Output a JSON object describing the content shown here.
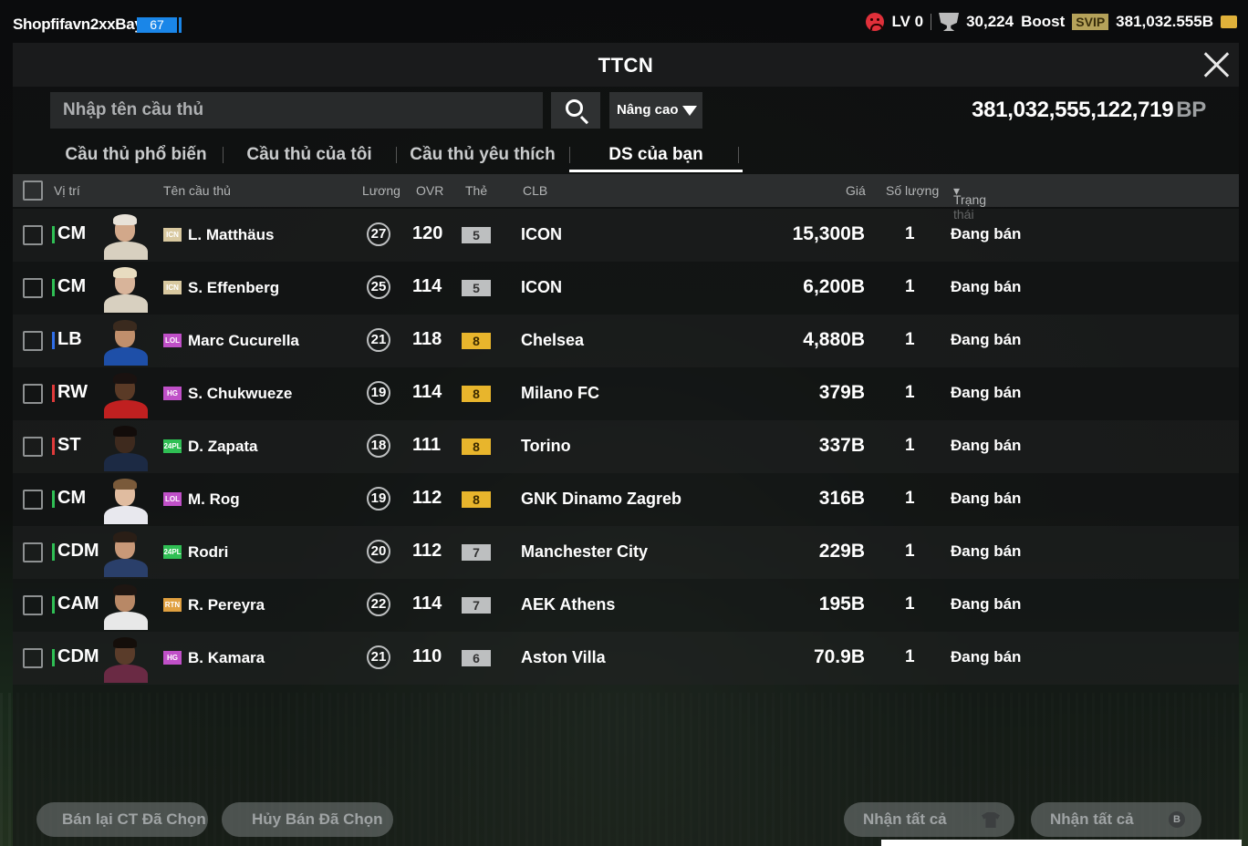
{
  "topbar": {
    "username": "Shopfifavn2xxBay",
    "level_badge": "67",
    "lv": "LV 0",
    "trophies": "30,224",
    "boost": "Boost",
    "svip": "SVIP",
    "coins": "381,032.555B"
  },
  "header": {
    "title": "TTCN"
  },
  "search": {
    "placeholder": "Nhập tên cầu thủ",
    "advanced_label": "Nâng cao"
  },
  "balance": {
    "amount": "381,032,555,122,719",
    "unit": "BP"
  },
  "tabs": [
    {
      "label": "Cầu thủ phổ biến"
    },
    {
      "label": "Cầu thủ của tôi"
    },
    {
      "label": "Cầu thủ yêu thích"
    },
    {
      "label": "DS của bạn"
    }
  ],
  "columns": {
    "position": "Vị trí",
    "name": "Tên cầu thủ",
    "salary": "Lương",
    "ovr": "OVR",
    "grade": "Thẻ",
    "club": "CLB",
    "price": "Giá",
    "quantity": "Số lượng",
    "status": "Trạng thái"
  },
  "rows": [
    {
      "pos": "CM",
      "pos_color": "#2fbf54",
      "season": "ICN",
      "season_color": "#d9c9a0",
      "name": "L. Matthäus",
      "salary": "27",
      "ovr": "120",
      "grade": "5",
      "grade_color": "#bdbfc0",
      "club": "ICON",
      "price": "15,300B",
      "qty": "1",
      "status": "Đang bán",
      "skin": "#d2a88a",
      "hair": "#e8e2d8",
      "shirt": "#d8d0c0"
    },
    {
      "pos": "CM",
      "pos_color": "#2fbf54",
      "season": "ICN",
      "season_color": "#d9c9a0",
      "name": "S. Effenberg",
      "salary": "25",
      "ovr": "114",
      "grade": "5",
      "grade_color": "#bdbfc0",
      "club": "ICON",
      "price": "6,200B",
      "qty": "1",
      "status": "Đang bán",
      "skin": "#d8b49a",
      "hair": "#e8dcc0",
      "shirt": "#d8d0c0"
    },
    {
      "pos": "LB",
      "pos_color": "#2f6ee8",
      "season": "LOL",
      "season_color": "#c050c8",
      "name": "Marc Cucurella",
      "salary": "21",
      "ovr": "118",
      "grade": "8",
      "grade_color": "#e8b52c",
      "club": "Chelsea",
      "price": "4,880B",
      "qty": "1",
      "status": "Đang bán",
      "skin": "#c08f6c",
      "hair": "#3a2a1e",
      "shirt": "#1e4fa8"
    },
    {
      "pos": "RW",
      "pos_color": "#e03a3a",
      "season": "HG",
      "season_color": "#c050c8",
      "name": "S. Chukwueze",
      "salary": "19",
      "ovr": "114",
      "grade": "8",
      "grade_color": "#e8b52c",
      "club": "Milano FC",
      "price": "379B",
      "qty": "1",
      "status": "Đang bán",
      "skin": "#5a3a26",
      "hair": "#1a1210",
      "shirt": "#c02020"
    },
    {
      "pos": "ST",
      "pos_color": "#e03a3a",
      "season": "24PL",
      "season_color": "#2fbf54",
      "name": "D. Zapata",
      "salary": "18",
      "ovr": "111",
      "grade": "8",
      "grade_color": "#e8b52c",
      "club": "Torino",
      "price": "337B",
      "qty": "1",
      "status": "Đang bán",
      "skin": "#3e2a1e",
      "hair": "#120c0a",
      "shirt": "#1c2a44"
    },
    {
      "pos": "CM",
      "pos_color": "#2fbf54",
      "season": "LOL",
      "season_color": "#c050c8",
      "name": "M. Rog",
      "salary": "19",
      "ovr": "112",
      "grade": "8",
      "grade_color": "#e8b52c",
      "club": "GNK Dinamo Zagreb",
      "price": "316B",
      "qty": "1",
      "status": "Đang bán",
      "skin": "#e0bca0",
      "hair": "#7a5a3a",
      "shirt": "#e8e8ee"
    },
    {
      "pos": "CDM",
      "pos_color": "#2fbf54",
      "season": "24PL",
      "season_color": "#2fbf54",
      "name": "Rodri",
      "salary": "20",
      "ovr": "112",
      "grade": "7",
      "grade_color": "#bdbfc0",
      "club": "Manchester City",
      "price": "229B",
      "qty": "1",
      "status": "Đang bán",
      "skin": "#c89878",
      "hair": "#2a1e16",
      "shirt": "#2a3f6a"
    },
    {
      "pos": "CAM",
      "pos_color": "#2fbf54",
      "season": "RTN",
      "season_color": "#e0a040",
      "name": "R. Pereyra",
      "salary": "22",
      "ovr": "114",
      "grade": "7",
      "grade_color": "#bdbfc0",
      "club": "AEK Athens",
      "price": "195B",
      "qty": "1",
      "status": "Đang bán",
      "skin": "#b88866",
      "hair": "#1e1612",
      "shirt": "#e8e8e8"
    },
    {
      "pos": "CDM",
      "pos_color": "#2fbf54",
      "season": "HG",
      "season_color": "#c050c8",
      "name": "B. Kamara",
      "salary": "21",
      "ovr": "110",
      "grade": "6",
      "grade_color": "#bdbfc0",
      "club": "Aston Villa",
      "price": "70.9B",
      "qty": "1",
      "status": "Đang bán",
      "skin": "#5a3c2a",
      "hair": "#140e0a",
      "shirt": "#6a2a44"
    }
  ],
  "bottom": {
    "resell_label": "Bán lại CT Đã Chọn",
    "cancel_label": "Hủy Bán Đã Chọn",
    "claim_players_label": "Nhận tất cả",
    "claim_bp_label": "Nhận tất cả",
    "claim_bp_icon_letter": "B"
  }
}
